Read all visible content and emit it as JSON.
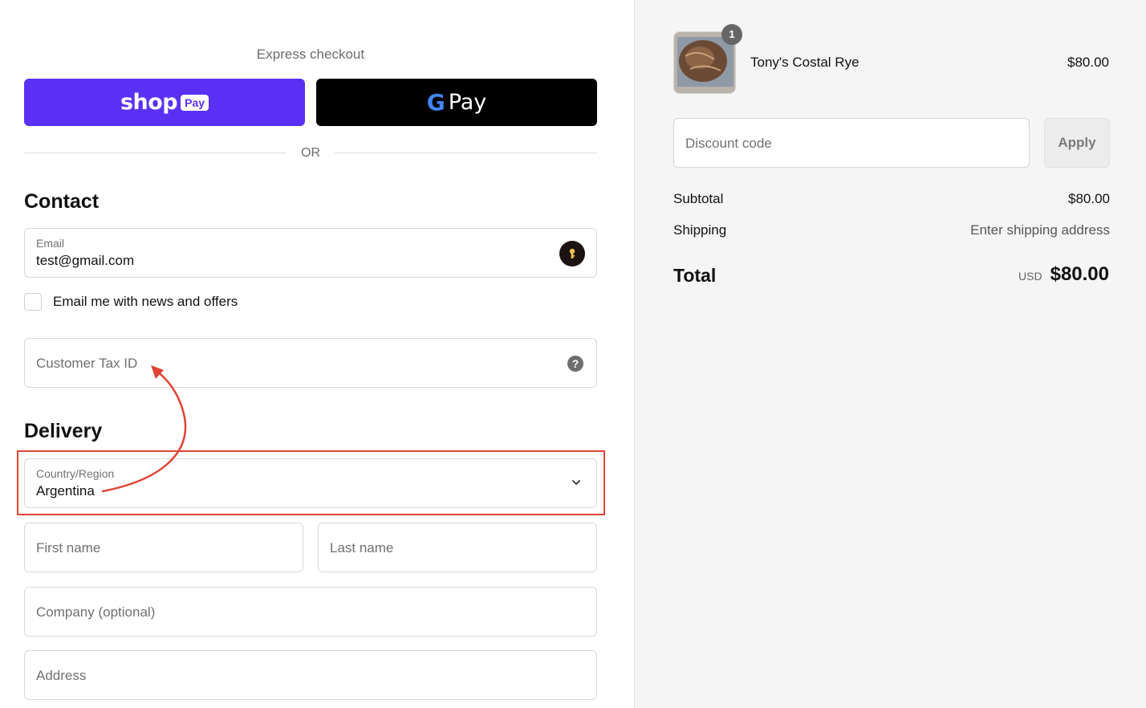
{
  "express": {
    "title": "Express checkout",
    "shop_pay": {
      "word": "shop",
      "badge": "Pay"
    },
    "google_pay": {
      "g": "G",
      "word": "Pay"
    },
    "or_text": "OR"
  },
  "contact": {
    "title": "Contact",
    "email": {
      "label": "Email",
      "value": "test@gmail.com"
    },
    "newsletter_label": "Email me with news and offers",
    "tax_id_placeholder": "Customer Tax ID",
    "help_glyph": "?"
  },
  "delivery": {
    "title": "Delivery",
    "country": {
      "label": "Country/Region",
      "value": "Argentina"
    },
    "first_name_placeholder": "First name",
    "last_name_placeholder": "Last name",
    "company_placeholder": "Company (optional)",
    "address_placeholder": "Address"
  },
  "annotation": {
    "color": "#e04434"
  },
  "summary": {
    "product": {
      "quantity": "1",
      "name": "Tony's Costal Rye",
      "price": "$80.00"
    },
    "discount_placeholder": "Discount code",
    "apply_label": "Apply",
    "subtotal_label": "Subtotal",
    "subtotal_value": "$80.00",
    "shipping_label": "Shipping",
    "shipping_value": "Enter shipping address",
    "total_label": "Total",
    "total_currency": "USD",
    "total_value": "$80.00"
  },
  "colors": {
    "shop_pay": "#5a31f4",
    "google_pay": "#000000",
    "sidebar_bg": "#f5f5f5"
  }
}
